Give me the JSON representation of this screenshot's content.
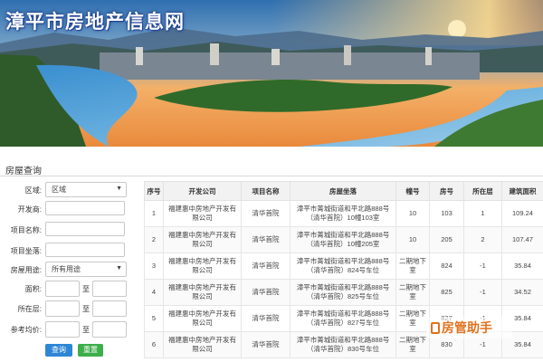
{
  "site": {
    "title": "漳平市房地产信息网"
  },
  "section": {
    "title": "房屋查询"
  },
  "form": {
    "district": {
      "label": "区域:",
      "value": "区域"
    },
    "developer": {
      "label": "开发商:",
      "value": ""
    },
    "project_name": {
      "label": "项目名称:",
      "value": ""
    },
    "project_location": {
      "label": "项目坐落:",
      "value": ""
    },
    "usage": {
      "label": "房屋用途:",
      "value": "所有用途"
    },
    "area": {
      "label": "面积:",
      "separator": "至"
    },
    "floor": {
      "label": "所在层:",
      "separator": "至"
    },
    "avg_price": {
      "label": "参考均价:",
      "separator": "至"
    },
    "search_label": "查询",
    "reset_label": "重置"
  },
  "table": {
    "headers": [
      "序号",
      "开发公司",
      "项目名称",
      "房屋坐落",
      "幢号",
      "房号",
      "所在层",
      "建筑面积"
    ],
    "rows": [
      [
        "1",
        "福建惠中房地产开发有限公司",
        "清华首院",
        "漳平市菁城街道和平北路888号（清华首院）10幢103室",
        "10",
        "103",
        "1",
        "109.24"
      ],
      [
        "2",
        "福建惠中房地产开发有限公司",
        "清华首院",
        "漳平市菁城街道和平北路888号（清华首院）10幢205室",
        "10",
        "205",
        "2",
        "107.47"
      ],
      [
        "3",
        "福建惠中房地产开发有限公司",
        "清华首院",
        "漳平市菁城街道和平北路888号（清华首院）824号车位",
        "二期地下室",
        "824",
        "-1",
        "35.84"
      ],
      [
        "4",
        "福建惠中房地产开发有限公司",
        "清华首院",
        "漳平市菁城街道和平北路888号（清华首院）825号车位",
        "二期地下室",
        "825",
        "-1",
        "34.52"
      ],
      [
        "5",
        "福建惠中房地产开发有限公司",
        "清华首院",
        "漳平市菁城街道和平北路888号（清华首院）827号车位",
        "二期地下室",
        "827",
        "-1",
        "35.84"
      ],
      [
        "6",
        "福建惠中房地产开发有限公司",
        "清华首院",
        "漳平市菁城街道和平北路888号（清华首院）830号车位",
        "二期地下室",
        "830",
        "-1",
        "35.84"
      ]
    ]
  },
  "watermark": {
    "text": "房管助手"
  },
  "colors": {
    "search_button": "#2e86d6",
    "reset_button": "#3cae4a",
    "title_text": "#ffffff",
    "watermark": "#e0731f"
  }
}
